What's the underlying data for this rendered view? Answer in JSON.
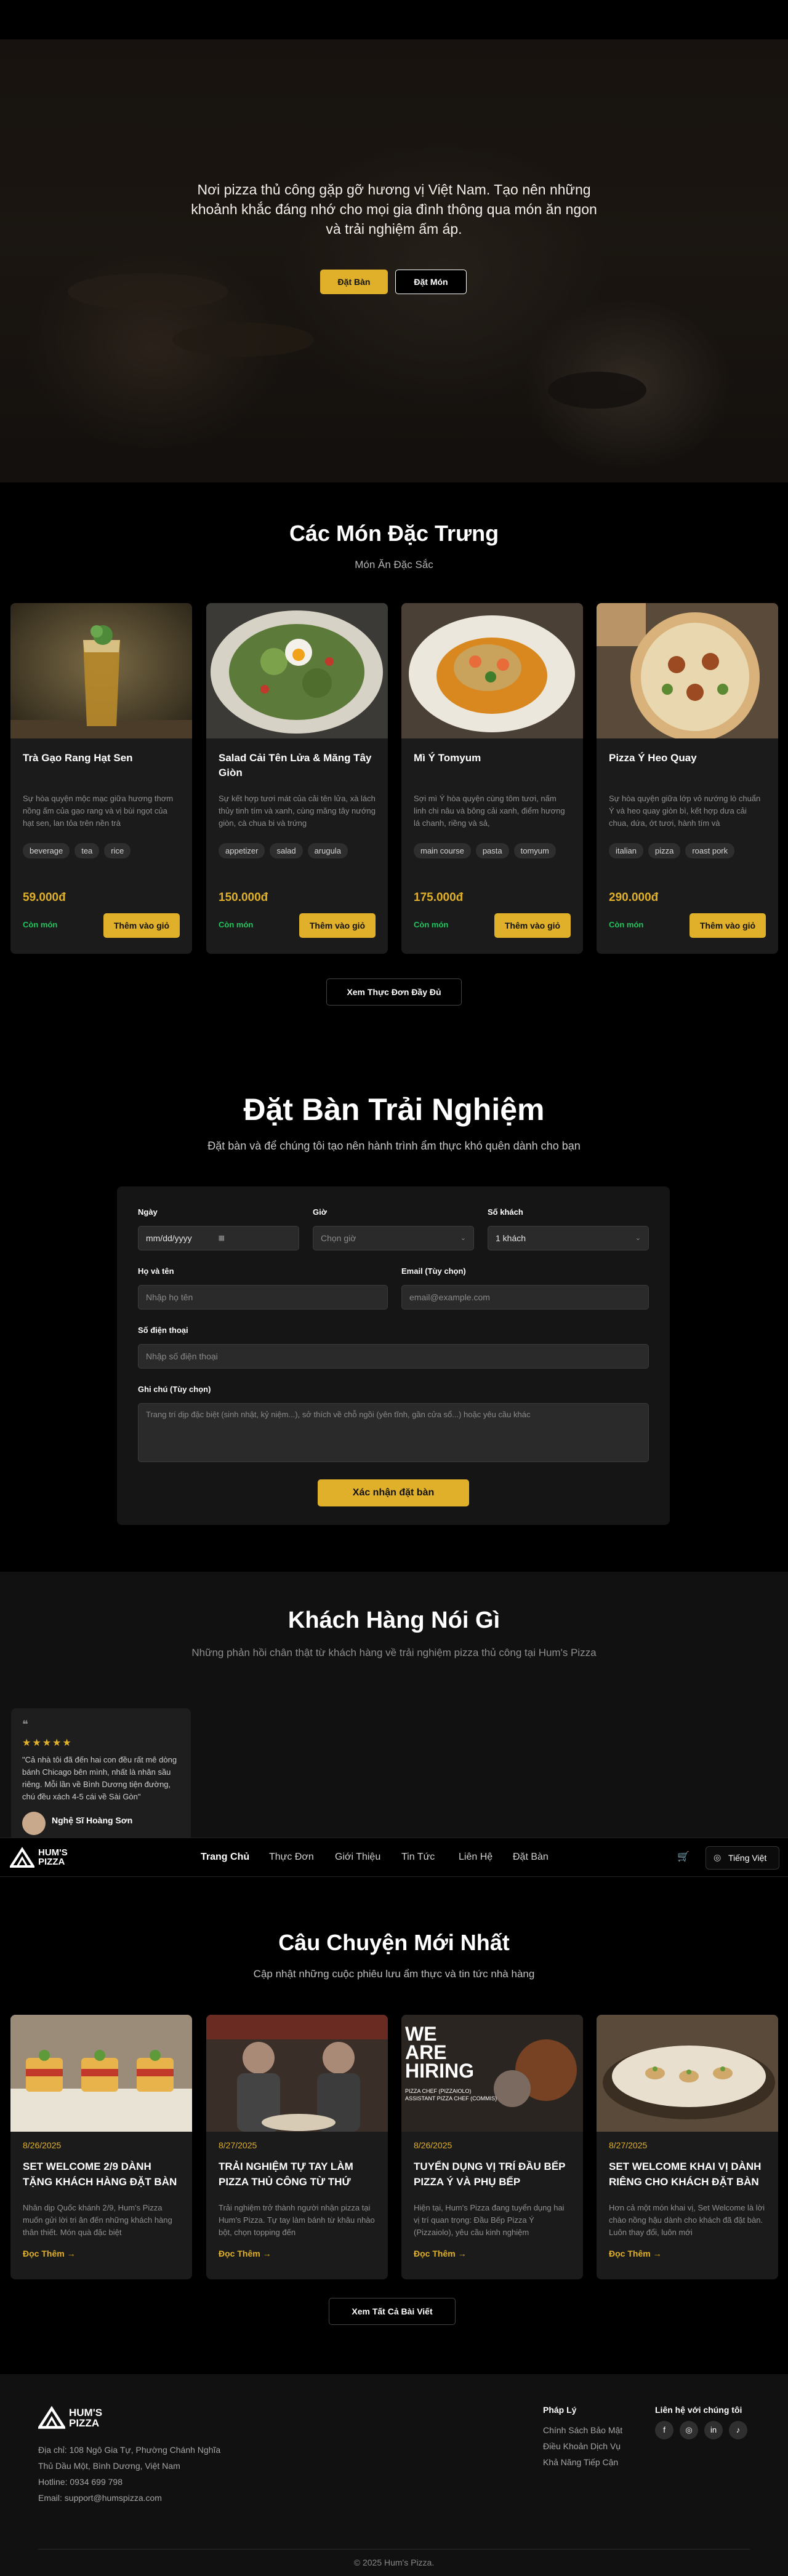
{
  "hero": {
    "text": "Nơi pizza thủ công gặp gỡ hương vị Việt Nam. Tạo nên những khoảnh khắc đáng nhớ cho mọi gia đình thông qua món ăn ngon và trải nghiệm ấm áp.",
    "book_label": "Đặt Bàn",
    "order_label": "Đặt Món"
  },
  "featured": {
    "title": "Các Món Đặc Trưng",
    "subtitle": "Món Ăn Đặc Sắc",
    "products": [
      {
        "name": "Trà Gạo Rang Hạt Sen",
        "desc": "Sự hòa quyện mộc mạc giữa hương thơm nồng ấm của gạo rang và vị bùi ngọt của hạt sen, lan tỏa trên nền trà",
        "tags": [
          "beverage",
          "tea",
          "rice"
        ],
        "price": "59.000đ",
        "stock": "Còn món",
        "add": "Thêm vào giỏ"
      },
      {
        "name": "Salad Cải Tên Lửa & Măng Tây Giòn",
        "desc": "Sự kết hợp tươi mát của cải tên lửa, xà lách thủy tinh tím và xanh, cùng măng tây nướng giòn, cà chua bi và trứng",
        "tags": [
          "appetizer",
          "salad",
          "arugula"
        ],
        "price": "150.000đ",
        "stock": "Còn món",
        "add": "Thêm vào giỏ"
      },
      {
        "name": "Mì Ý Tomyum",
        "desc": "Sợi mì Ý hòa quyện cùng tôm tươi, nấm linh chi nâu và bông cải xanh, điểm hương lá chanh, riềng và sả,",
        "tags": [
          "main course",
          "pasta",
          "tomyum"
        ],
        "price": "175.000đ",
        "stock": "Còn món",
        "add": "Thêm vào giỏ"
      },
      {
        "name": "Pizza Ý Heo Quay",
        "desc": "Sự hòa quyện giữa lớp vỏ nướng lò chuẩn Ý và heo quay giòn bì, kết hợp dưa cải chua, dứa, ớt tươi, hành tím và",
        "tags": [
          "italian",
          "pizza",
          "roast pork"
        ],
        "price": "290.000đ",
        "stock": "Còn món",
        "add": "Thêm vào giỏ"
      }
    ],
    "see_menu": "Xem Thực Đơn Đầy Đủ"
  },
  "booking": {
    "title": "Đặt Bàn Trải Nghiệm",
    "subtitle": "Đặt bàn và để chúng tôi tạo nên hành trình ẩm thực khó quên dành cho bạn",
    "date_label": "Ngày",
    "date_placeholder": "mm/dd/yyyy",
    "time_label": "Giờ",
    "time_placeholder": "Chọn giờ",
    "guests_label": "Số khách",
    "guests_value": "1 khách",
    "name_label": "Họ và tên",
    "name_placeholder": "Nhập họ tên",
    "email_label": "Email (Tùy chọn)",
    "email_placeholder": "email@example.com",
    "phone_label": "Số điện thoại",
    "phone_placeholder": "Nhập số điện thoại",
    "note_label": "Ghi chú (Tùy chọn)",
    "note_placeholder": "Trang trí dịp đặc biệt (sinh nhật, kỷ niệm...), sở thích về chỗ ngồi (yên tĩnh, gần cửa sổ...) hoặc yêu cầu khác",
    "submit": "Xác nhận đặt bàn"
  },
  "testimonials": {
    "title": "Khách Hàng Nói Gì",
    "subtitle": "Những phản hồi chân thật từ khách hàng về trải nghiệm pizza thủ công tại Hum's Pizza",
    "items": [
      {
        "stars": "★★★★★",
        "quote": "\"Cả nhà tôi đã đến hai con đều rất mê dòng bánh Chicago bên mình, nhất là nhân sầu riêng. Mỗi lần về Bình Dương tiện đường, chú đều xách 4-5 cái về Sài Gòn\"",
        "name": "Nghệ Sĩ Hoàng Sơn"
      }
    ]
  },
  "nav": {
    "logo_line1": "HUM'S",
    "logo_line2": "PIZZA",
    "links": [
      "Trang Chủ",
      "Thực Đơn",
      "Giới Thiệu",
      "Tin Tức",
      "Liên Hệ",
      "Đặt Bàn"
    ],
    "language": "Tiếng Việt"
  },
  "blog": {
    "title": "Câu Chuyện Mới Nhất",
    "subtitle": "Cập nhật những cuộc phiêu lưu ẩm thực và tin tức nhà hàng",
    "posts": [
      {
        "date": "8/26/2025",
        "title": "SET WELCOME 2/9 DÀNH TẶNG KHÁCH HÀNG ĐẶT BÀN",
        "desc": "Nhân dịp Quốc khánh 2/9, Hum's Pizza muốn gửi lời tri ân đến những khách hàng thân thiết. Món quà đặc biệt",
        "more": "Đọc Thêm →"
      },
      {
        "date": "8/27/2025",
        "title": "TRẢI NGHIỆM TỰ TAY LÀM PIZZA THỦ CÔNG TỪ THỨ BẢY",
        "desc": "Trải nghiệm trở thành người nhận pizza tại Hum's Pizza. Tự tay làm bánh từ khâu nhào bột, chọn topping đến",
        "more": "Đọc Thêm →"
      },
      {
        "date": "8/26/2025",
        "title": "TUYỂN DỤNG VỊ TRÍ ĐẦU BẾP PIZZA Ý VÀ PHỤ BẾP",
        "desc": "Hiện tại, Hum's Pizza đang tuyển dụng hai vị trí quan trọng: Đầu Bếp Pizza Ý (Pizzaiolo), yêu cầu kinh nghiệm",
        "more": "Đọc Thêm →",
        "image_text": [
          "WE",
          "ARE",
          "HIRING",
          "PIZZA CHEF (PIZZAIOLO)",
          "ASSISTANT PIZZA CHEF (COMMIS)"
        ]
      },
      {
        "date": "8/27/2025",
        "title": "SET WELCOME KHAI VỊ DÀNH RIÊNG CHO KHÁCH ĐẶT BÀN",
        "desc": "Hơn cả một món khai vị, Set Welcome là lời chào nồng hậu dành cho khách đã đặt bàn. Luôn thay đổi, luôn mới",
        "more": "Đọc Thêm →"
      }
    ],
    "see_all": "Xem Tất Cả Bài Viết"
  },
  "footer": {
    "logo_line1": "HUM'S",
    "logo_line2": "PIZZA",
    "address_line1": "Địa chỉ: 108 Ngô Gia Tự, Phường Chánh Nghĩa",
    "address_line2": "Thủ Dầu Một, Bình Dương, Việt Nam",
    "hotline": "Hotline: 0934 699 798",
    "email": "Email: support@humspizza.com",
    "legal_title": "Pháp Lý",
    "legal_links": [
      "Chính Sách Bảo Mật",
      "Điều Khoản Dịch Vụ",
      "Khả Năng Tiếp Cận"
    ],
    "contact_title": "Liên hệ với chúng tôi",
    "social": [
      "facebook-icon",
      "instagram-icon",
      "linkedin-icon",
      "tiktok-icon"
    ],
    "copyright": "© 2025 Hum's Pizza."
  },
  "colors": {
    "accent": "#e0b02a",
    "background": "#000000",
    "card": "#1b1b1b",
    "in_stock": "#22c55e"
  }
}
